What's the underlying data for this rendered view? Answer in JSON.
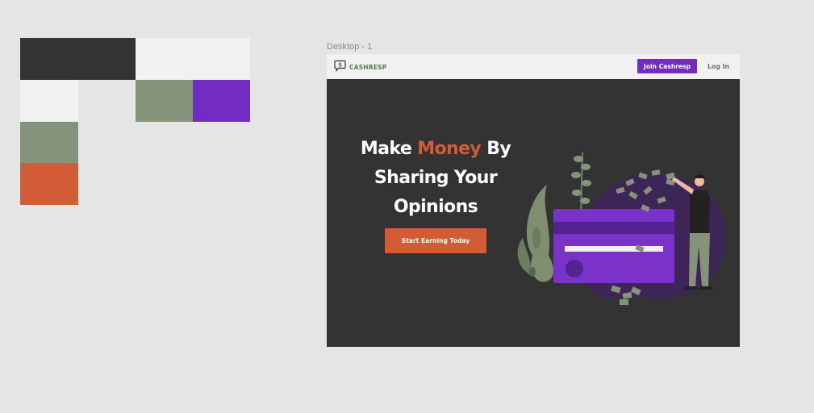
{
  "palette": {
    "colors": {
      "dark": "#333333",
      "light": "#f1f1f1",
      "sage": "#85937a",
      "purple": "#722cc2",
      "orange": "#d15c35"
    }
  },
  "frame": {
    "label": "Desktop - 1"
  },
  "nav": {
    "logo_text": "CASHRESP",
    "logo_icon": "chat-dollar-icon",
    "join_label": "Join Cashresp",
    "login_label": "Log In"
  },
  "hero": {
    "title_before": "Make ",
    "title_accent": "Money",
    "title_after": " By Sharing Your Opinions",
    "cta_label": "Start Earning Today"
  },
  "illustration": {
    "icon": "credit-card-money-illustration"
  }
}
